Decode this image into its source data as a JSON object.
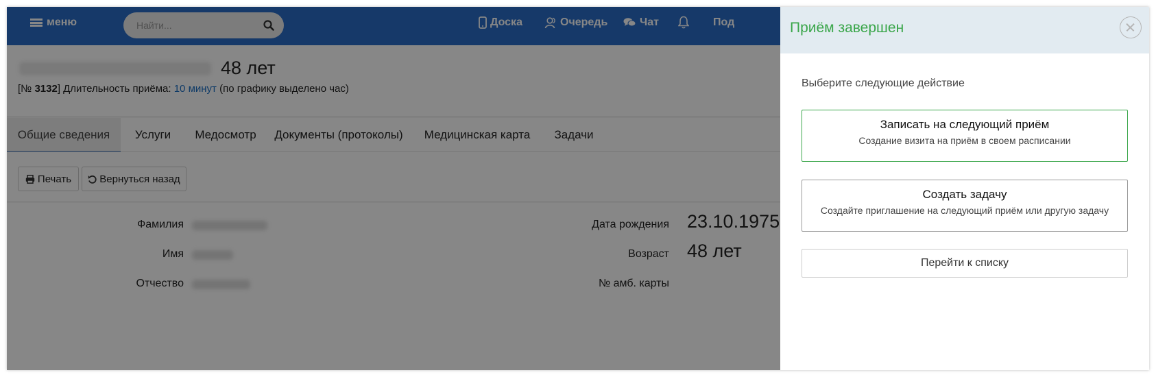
{
  "header": {
    "menu_label": "меню",
    "search_placeholder": "Найти...",
    "nav": [
      {
        "label": "Доска"
      },
      {
        "label": "Очередь"
      },
      {
        "label": "Чат"
      },
      {
        "label": ""
      },
      {
        "label": "Под"
      }
    ]
  },
  "patient": {
    "age": "48 лет",
    "visit_prefix": "[№ ",
    "visit_number": "3132",
    "visit_mid": "] Длительность приёма: ",
    "duration": "10 минут",
    "visit_suffix": " (по графику выделено час)"
  },
  "tabs": [
    {
      "label": "Общие сведения",
      "active": true
    },
    {
      "label": "Услуги"
    },
    {
      "label": "Медосмотр"
    },
    {
      "label": "Документы (протоколы)"
    },
    {
      "label": "Медицинская карта"
    },
    {
      "label": "Задачи"
    }
  ],
  "toolbar": {
    "print_label": "Печать",
    "back_label": "Вернуться назад"
  },
  "fields": {
    "last_name_label": "Фамилия",
    "first_name_label": "Имя",
    "patronymic_label": "Отчество",
    "birth_label": "Дата рождения",
    "birth_value": "23.10.1975",
    "age_label": "Возраст",
    "age_value": "48 лет",
    "card_label": "№ амб. карты"
  },
  "panel": {
    "title": "Приём завершен",
    "prompt": "Выберите следующие действие",
    "options": [
      {
        "title": "Записать на следующий приём",
        "subtitle": "Создание визита на приём в своем расписании"
      },
      {
        "title": "Создать задачу",
        "subtitle": "Создайте приглашение на следующий приём или другую задачу"
      },
      {
        "title": "Перейти к списку"
      }
    ]
  },
  "colors": {
    "topbar": "#2a6cc6",
    "accent_green": "#3aa64a",
    "link_blue": "#1c6fc2",
    "panel_header": "#e2ebf1"
  }
}
